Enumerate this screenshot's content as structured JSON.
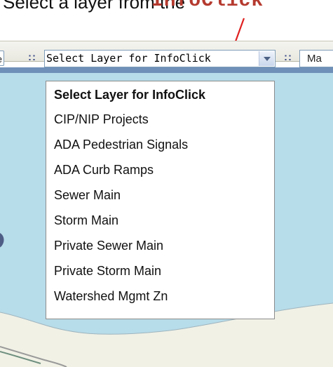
{
  "caption": {
    "text": "Select a layer from the",
    "highlight": "InfoClick"
  },
  "toolbar": {
    "left_button_label": "e",
    "separator": "::",
    "select_value": "Select Layer for InfoClick",
    "right_button_label": "Ma"
  },
  "dropdown": {
    "items": [
      "Select Layer for InfoClick",
      "CIP/NIP Projects",
      "ADA Pedestrian Signals",
      "ADA Curb Ramps",
      "Sewer Main",
      "Storm Main",
      "Private Sewer Main",
      "Private Storm Main",
      "Watershed Mgmt Zn"
    ]
  },
  "colors": {
    "caption_highlight": "#b53a2f",
    "arrow": "#e02020",
    "water": "#b7dcea",
    "land": "#f1f1e6",
    "map_header": "#6f90b8"
  }
}
